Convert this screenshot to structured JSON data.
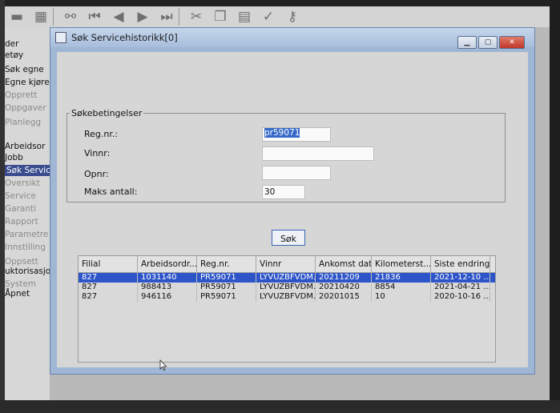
{
  "toolbar": {
    "icons": [
      "disk-icon",
      "grid-icon",
      "binoculars-icon",
      "first-icon",
      "prev-icon",
      "next-icon",
      "last-icon",
      "cut-icon",
      "copy-icon",
      "paste-icon",
      "check-icon",
      "key-icon"
    ]
  },
  "sidebar": {
    "items": [
      {
        "label": "der",
        "dim": false
      },
      {
        "label": "etøy",
        "dim": false
      },
      {
        "label": "Søk egne",
        "dim": false
      },
      {
        "label": "Egne kjøre",
        "dim": false
      },
      {
        "label": "Opprett",
        "dim": true
      },
      {
        "label": "Oppgaver",
        "dim": true
      },
      {
        "label": "Planlegg",
        "dim": true
      },
      {
        "label": "Arbeidsor",
        "dim": false
      },
      {
        "label": "Jobb",
        "dim": false
      },
      {
        "label": "Søk Servic",
        "dim": false,
        "selected": true
      },
      {
        "label": "Oversikt",
        "dim": true
      },
      {
        "label": "Service",
        "dim": true
      },
      {
        "label": "Garanti",
        "dim": true
      },
      {
        "label": "Rapport",
        "dim": true
      },
      {
        "label": "Parametre",
        "dim": true
      },
      {
        "label": "Innstilling",
        "dim": true
      },
      {
        "label": "Oppsett",
        "dim": true
      },
      {
        "label": "uktorisasjon",
        "dim": false
      },
      {
        "label": "System",
        "dim": true
      },
      {
        "label": "Åpnet",
        "dim": false
      }
    ]
  },
  "window": {
    "title": "Søk Servicehistorikk[0]",
    "minimize": "▁",
    "maximize": "▢",
    "close": "✕"
  },
  "criteria": {
    "legend": "Søkebetingelser",
    "regnr_label": "Reg.nr.:",
    "regnr_value": "pr59071",
    "vinnr_label": "Vinnr:",
    "vinnr_value": "",
    "opnr_label": "Opnr:",
    "opnr_value": "",
    "maks_label": "Maks antall:",
    "maks_value": "30"
  },
  "search_button": "Søk",
  "table": {
    "columns": [
      "Filial",
      "Arbeidsordr...",
      "Reg.nr.",
      "Vinnr",
      "Ankomst dato",
      "Kilometerst...",
      "Siste endring"
    ],
    "rows": [
      [
        "827",
        "1031140",
        "PR59071",
        "LYVUZBFVDM...",
        "20211209",
        "21836",
        "2021-12-10 ..."
      ],
      [
        "827",
        "988413",
        "PR59071",
        "LYVUZBFVDM...",
        "20210420",
        "8854",
        "2021-04-21 ..."
      ],
      [
        "827",
        "946116",
        "PR59071",
        "LYVUZBFVDM...",
        "20201015",
        "10",
        "2020-10-16 ..."
      ]
    ],
    "selected_row": 0
  },
  "colors": {
    "selection": "#2d55c9",
    "window_frame": "#9fb6d4",
    "panel": "#d6d6d6"
  }
}
